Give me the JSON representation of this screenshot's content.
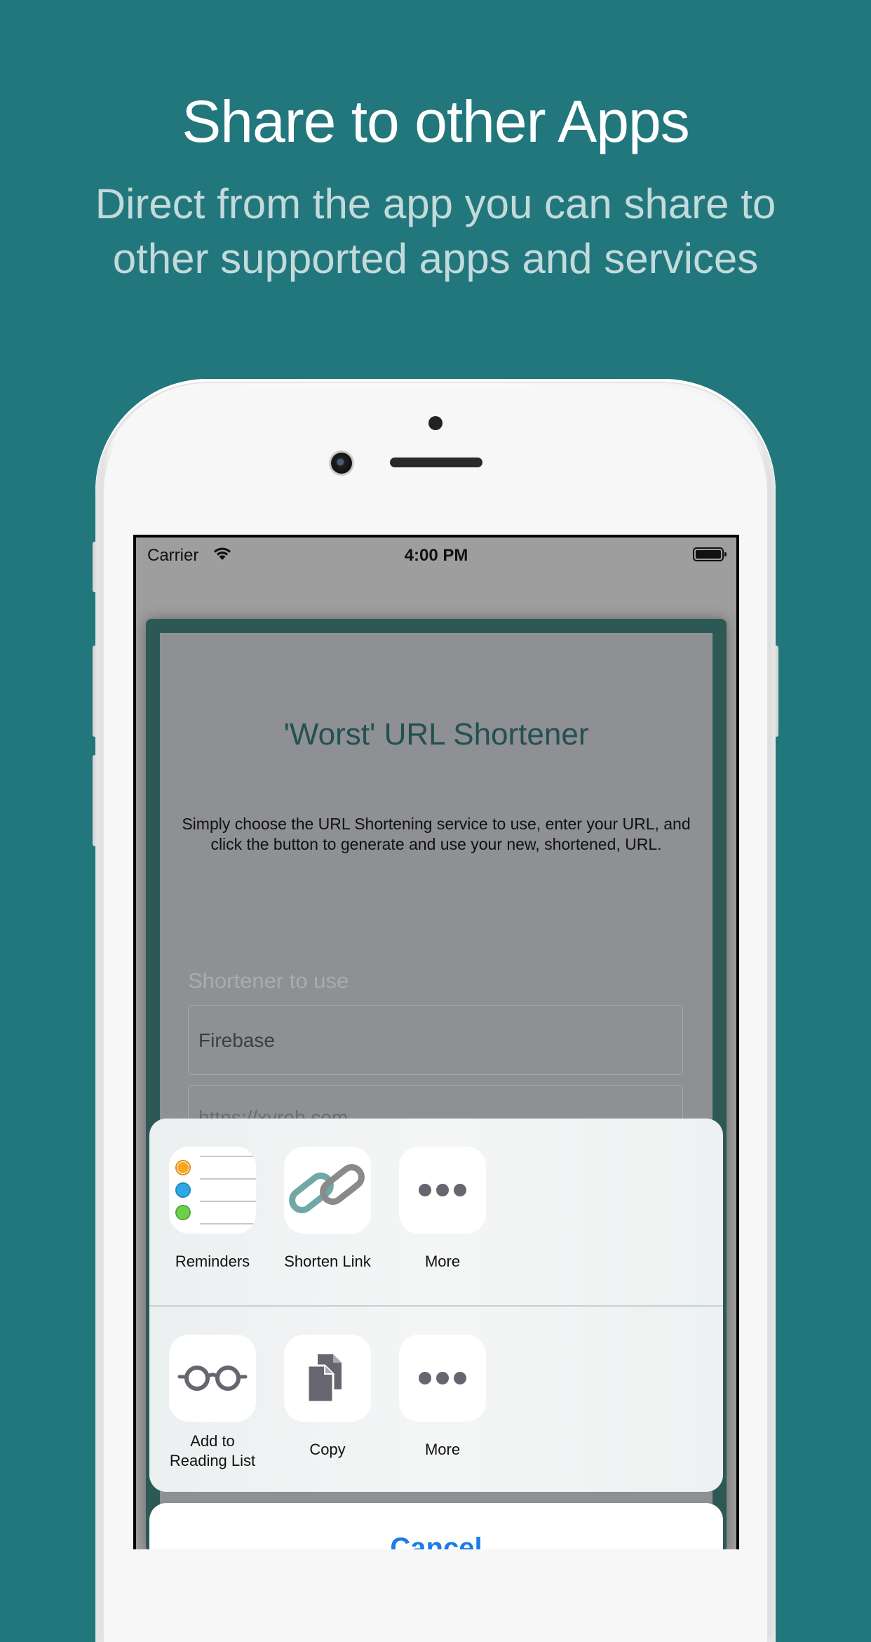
{
  "header": {
    "title": "Share to other Apps",
    "subtitle": "Direct from the app you can share to other supported apps and services"
  },
  "status_bar": {
    "carrier": "Carrier",
    "time": "4:00 PM"
  },
  "app": {
    "title": "'Worst' URL Shortener",
    "description": "Simply choose the URL Shortening service to use, enter your URL, and click the button to generate and use your new, shortened, URL.",
    "shortener_label": "Shortener to use",
    "shortener_value": "Firebase",
    "url_value": "https://xyrob.com"
  },
  "share_sheet": {
    "apps": [
      {
        "label": "Reminders",
        "icon": "reminders-icon"
      },
      {
        "label": "Shorten Link",
        "icon": "link-icon"
      },
      {
        "label": "More",
        "icon": "more-icon"
      }
    ],
    "actions": [
      {
        "label_line1": "Add to",
        "label_line2": "Reading List",
        "icon": "glasses-icon"
      },
      {
        "label": "Copy",
        "icon": "copy-icon"
      },
      {
        "label": "More",
        "icon": "more-icon"
      }
    ],
    "cancel_label": "Cancel"
  },
  "colors": {
    "background": "#22777d",
    "cancel_blue": "#1a7ce8",
    "app_title": "#22514f"
  }
}
